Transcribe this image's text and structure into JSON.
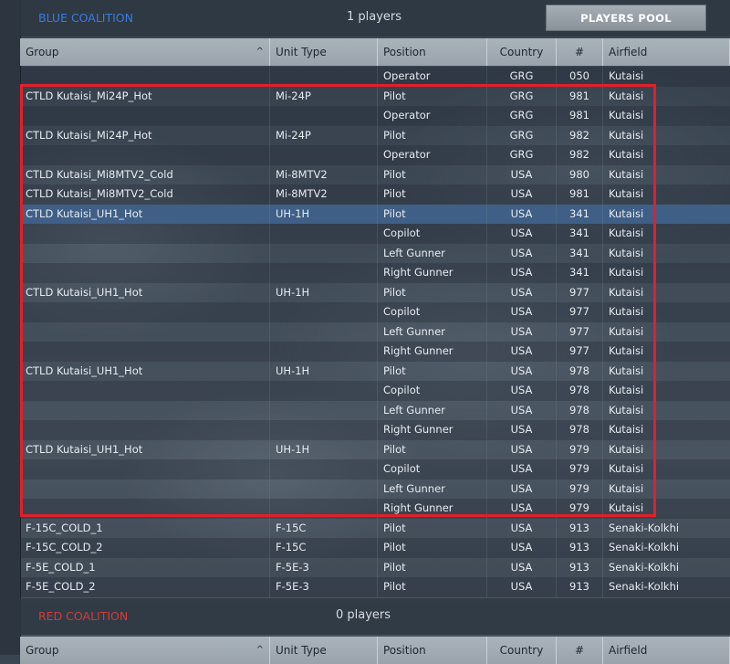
{
  "blue": {
    "title": "BLUE COALITION",
    "players": "1 players",
    "pool_button": "PLAYERS POOL"
  },
  "red": {
    "title": "RED COALITION",
    "players": "0 players"
  },
  "columns": [
    "Group",
    "Unit Type",
    "Position",
    "Country",
    "#",
    "Airfield"
  ],
  "sort_arrow": "^",
  "rows": [
    {
      "group": "",
      "unit": "",
      "position": "Operator",
      "country": "GRG",
      "num": "050",
      "airfield": "Kutaisi"
    },
    {
      "group": "CTLD Kutaisi_Mi24P_Hot",
      "unit": "Mi-24P",
      "position": "Pilot",
      "country": "GRG",
      "num": "981",
      "airfield": "Kutaisi"
    },
    {
      "group": "",
      "unit": "",
      "position": "Operator",
      "country": "GRG",
      "num": "981",
      "airfield": "Kutaisi"
    },
    {
      "group": "CTLD Kutaisi_Mi24P_Hot",
      "unit": "Mi-24P",
      "position": "Pilot",
      "country": "GRG",
      "num": "982",
      "airfield": "Kutaisi"
    },
    {
      "group": "",
      "unit": "",
      "position": "Operator",
      "country": "GRG",
      "num": "982",
      "airfield": "Kutaisi"
    },
    {
      "group": "CTLD Kutaisi_Mi8MTV2_Cold",
      "unit": "Mi-8MTV2",
      "position": "Pilot",
      "country": "USA",
      "num": "980",
      "airfield": "Kutaisi"
    },
    {
      "group": "CTLD Kutaisi_Mi8MTV2_Cold",
      "unit": "Mi-8MTV2",
      "position": "Pilot",
      "country": "USA",
      "num": "981",
      "airfield": "Kutaisi"
    },
    {
      "group": "CTLD Kutaisi_UH1_Hot",
      "unit": "UH-1H",
      "position": "Pilot",
      "country": "USA",
      "num": "341",
      "airfield": "Kutaisi",
      "selected": true
    },
    {
      "group": "",
      "unit": "",
      "position": "Copilot",
      "country": "USA",
      "num": "341",
      "airfield": "Kutaisi"
    },
    {
      "group": "",
      "unit": "",
      "position": "Left Gunner",
      "country": "USA",
      "num": "341",
      "airfield": "Kutaisi"
    },
    {
      "group": "",
      "unit": "",
      "position": "Right Gunner",
      "country": "USA",
      "num": "341",
      "airfield": "Kutaisi"
    },
    {
      "group": "CTLD Kutaisi_UH1_Hot",
      "unit": "UH-1H",
      "position": "Pilot",
      "country": "USA",
      "num": "977",
      "airfield": "Kutaisi"
    },
    {
      "group": "",
      "unit": "",
      "position": "Copilot",
      "country": "USA",
      "num": "977",
      "airfield": "Kutaisi"
    },
    {
      "group": "",
      "unit": "",
      "position": "Left Gunner",
      "country": "USA",
      "num": "977",
      "airfield": "Kutaisi"
    },
    {
      "group": "",
      "unit": "",
      "position": "Right Gunner",
      "country": "USA",
      "num": "977",
      "airfield": "Kutaisi"
    },
    {
      "group": "CTLD Kutaisi_UH1_Hot",
      "unit": "UH-1H",
      "position": "Pilot",
      "country": "USA",
      "num": "978",
      "airfield": "Kutaisi"
    },
    {
      "group": "",
      "unit": "",
      "position": "Copilot",
      "country": "USA",
      "num": "978",
      "airfield": "Kutaisi"
    },
    {
      "group": "",
      "unit": "",
      "position": "Left Gunner",
      "country": "USA",
      "num": "978",
      "airfield": "Kutaisi"
    },
    {
      "group": "",
      "unit": "",
      "position": "Right Gunner",
      "country": "USA",
      "num": "978",
      "airfield": "Kutaisi"
    },
    {
      "group": "CTLD Kutaisi_UH1_Hot",
      "unit": "UH-1H",
      "position": "Pilot",
      "country": "USA",
      "num": "979",
      "airfield": "Kutaisi"
    },
    {
      "group": "",
      "unit": "",
      "position": "Copilot",
      "country": "USA",
      "num": "979",
      "airfield": "Kutaisi"
    },
    {
      "group": "",
      "unit": "",
      "position": "Left Gunner",
      "country": "USA",
      "num": "979",
      "airfield": "Kutaisi"
    },
    {
      "group": "",
      "unit": "",
      "position": "Right Gunner",
      "country": "USA",
      "num": "979",
      "airfield": "Kutaisi"
    },
    {
      "group": "F-15C_COLD_1",
      "unit": "F-15C",
      "position": "Pilot",
      "country": "USA",
      "num": "913",
      "airfield": "Senaki-Kolkhi"
    },
    {
      "group": "F-15C_COLD_2",
      "unit": "F-15C",
      "position": "Pilot",
      "country": "USA",
      "num": "913",
      "airfield": "Senaki-Kolkhi"
    },
    {
      "group": "F-5E_COLD_1",
      "unit": "F-5E-3",
      "position": "Pilot",
      "country": "USA",
      "num": "913",
      "airfield": "Senaki-Kolkhi"
    },
    {
      "group": "F-5E_COLD_2",
      "unit": "F-5E-3",
      "position": "Pilot",
      "country": "USA",
      "num": "913",
      "airfield": "Senaki-Kolkhi"
    }
  ]
}
